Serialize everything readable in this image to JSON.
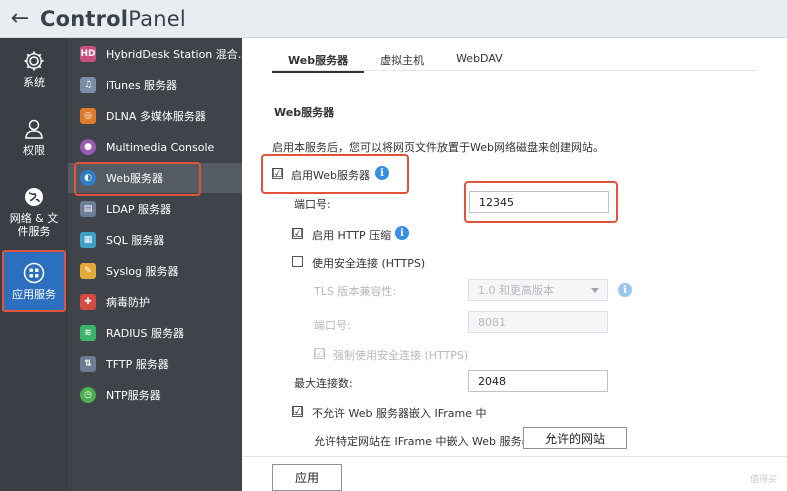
{
  "header": {
    "back_icon": "arrow-left-icon",
    "title_bold": "Control",
    "title_rest": "Panel"
  },
  "rail": [
    {
      "label": "系统",
      "icon": "gear-icon"
    },
    {
      "label": "权限",
      "icon": "user-icon"
    },
    {
      "label": "网络 & 文件服务",
      "icon": "globe-icon"
    },
    {
      "label": "应用服务",
      "icon": "apps-icon"
    }
  ],
  "list": [
    {
      "label": "HybridDesk Station 混合…",
      "icon": "hd-icon",
      "color": "#c94f7c",
      "glyph": "HD"
    },
    {
      "label": "iTunes 服务器",
      "icon": "itunes-icon",
      "color": "#7a8ea6",
      "glyph": "♫"
    },
    {
      "label": "DLNA 多媒体服务器",
      "icon": "dlna-icon",
      "color": "#e07b2b",
      "glyph": "◎"
    },
    {
      "label": "Multimedia Console",
      "icon": "multimedia-icon",
      "color": "#9b59b6",
      "glyph": "●"
    },
    {
      "label": "Web服务器",
      "icon": "web-icon",
      "color": "#2f7fc8",
      "glyph": "◐"
    },
    {
      "label": "LDAP 服务器",
      "icon": "ldap-icon",
      "color": "#6d7d95",
      "glyph": "▤"
    },
    {
      "label": "SQL 服务器",
      "icon": "sql-icon",
      "color": "#3fa0c8",
      "glyph": "▦"
    },
    {
      "label": "Syslog 服务器",
      "icon": "syslog-icon",
      "color": "#e2a93b",
      "glyph": "✎"
    },
    {
      "label": "病毒防护",
      "icon": "antivirus-icon",
      "color": "#d64b3f",
      "glyph": "✚"
    },
    {
      "label": "RADIUS 服务器",
      "icon": "radius-icon",
      "color": "#3bb36b",
      "glyph": "≋"
    },
    {
      "label": "TFTP 服务器",
      "icon": "tftp-icon",
      "color": "#6c7c92",
      "glyph": "⇅"
    },
    {
      "label": "NTP服务器",
      "icon": "ntp-icon",
      "color": "#4caf50",
      "glyph": "◷"
    }
  ],
  "tabs": [
    "Web服务器",
    "虚拟主机",
    "WebDAV"
  ],
  "form": {
    "section_title": "Web服务器",
    "description": "启用本服务后，您可以将网页文件放置于Web网络磁盘来创建网站。",
    "enable_web_label": "启用Web服务器",
    "enable_web_checked": "☑",
    "port_label": "端口号:",
    "port_value": "12345",
    "http_compress_label": "启用 HTTP 压缩",
    "http_compress_checked": "☑",
    "https_label": "使用安全连接 (HTTPS)",
    "tls_label": "TLS 版本兼容性:",
    "tls_value": "1.0 和更高版本",
    "https_port_label": "端口号:",
    "https_port_placeholder": "8081",
    "force_https_label": "强制使用安全连接 (HTTPS)",
    "max_conn_label": "最大连接数:",
    "max_conn_value": "2048",
    "iframe_label": "不允许 Web 服务器嵌入 IFrame 中",
    "iframe_checked": "☑",
    "iframe_allow_label": "允许特定网站在 IFrame 中嵌入 Web 服务器",
    "iframe_allow_button": "允许的网站",
    "apply_button": "应用"
  },
  "colors": {
    "highlight": "#e0543a",
    "accent": "#2d6fbf",
    "info": "#3a8ee6"
  },
  "watermark": "值得买"
}
